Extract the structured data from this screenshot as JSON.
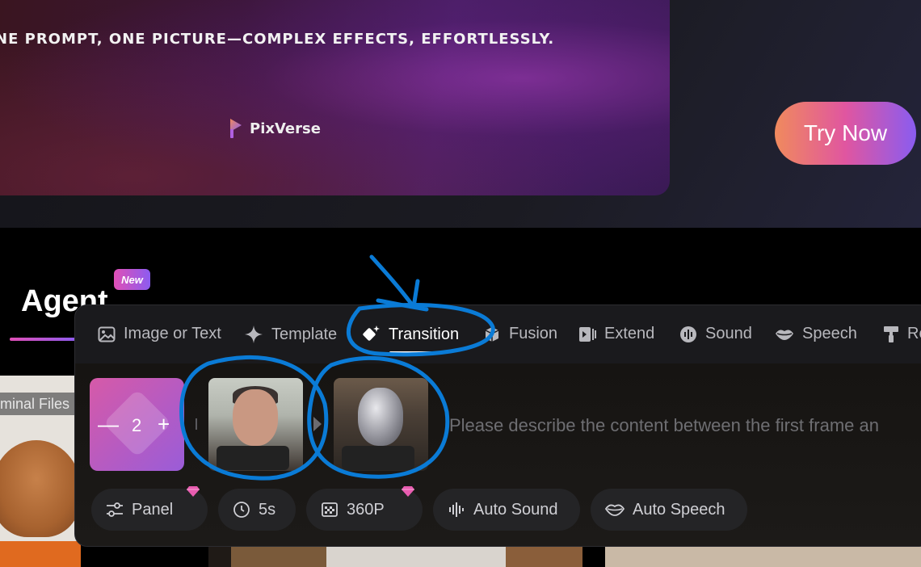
{
  "banner": {
    "headline": "NE PROMPT, ONE PICTURE—COMPLEX EFFECTS, EFFORTLESSLY.",
    "brand_name": "PixVerse",
    "try_now_label": "Try Now"
  },
  "agent": {
    "title": "Agent",
    "badge": "New"
  },
  "background": {
    "file_tag": "minal Files"
  },
  "tabs": [
    {
      "label": "Image or Text",
      "icon": "image-icon"
    },
    {
      "label": "Template",
      "icon": "sparkle-icon"
    },
    {
      "label": "Transition",
      "icon": "diamond-sparkle-icon",
      "active": true
    },
    {
      "label": "Fusion",
      "icon": "cube-icon"
    },
    {
      "label": "Extend",
      "icon": "extend-icon"
    },
    {
      "label": "Sound",
      "icon": "waveform-icon"
    },
    {
      "label": "Speech",
      "icon": "lips-icon"
    },
    {
      "label": "Re",
      "icon": "paint-roller-icon"
    }
  ],
  "frames": {
    "count": "2",
    "minus": "—",
    "plus": "+"
  },
  "prompt": {
    "placeholder": "Please describe the content between the first frame an"
  },
  "chips": {
    "panel": "Panel",
    "duration": "5s",
    "resolution": "360P",
    "auto_sound": "Auto Sound",
    "auto_speech": "Auto Speech"
  },
  "colors": {
    "accent_gradient_start": "#e04fb6",
    "accent_gradient_end": "#8c5cf0",
    "annotation_blue": "#0a7bd6"
  }
}
